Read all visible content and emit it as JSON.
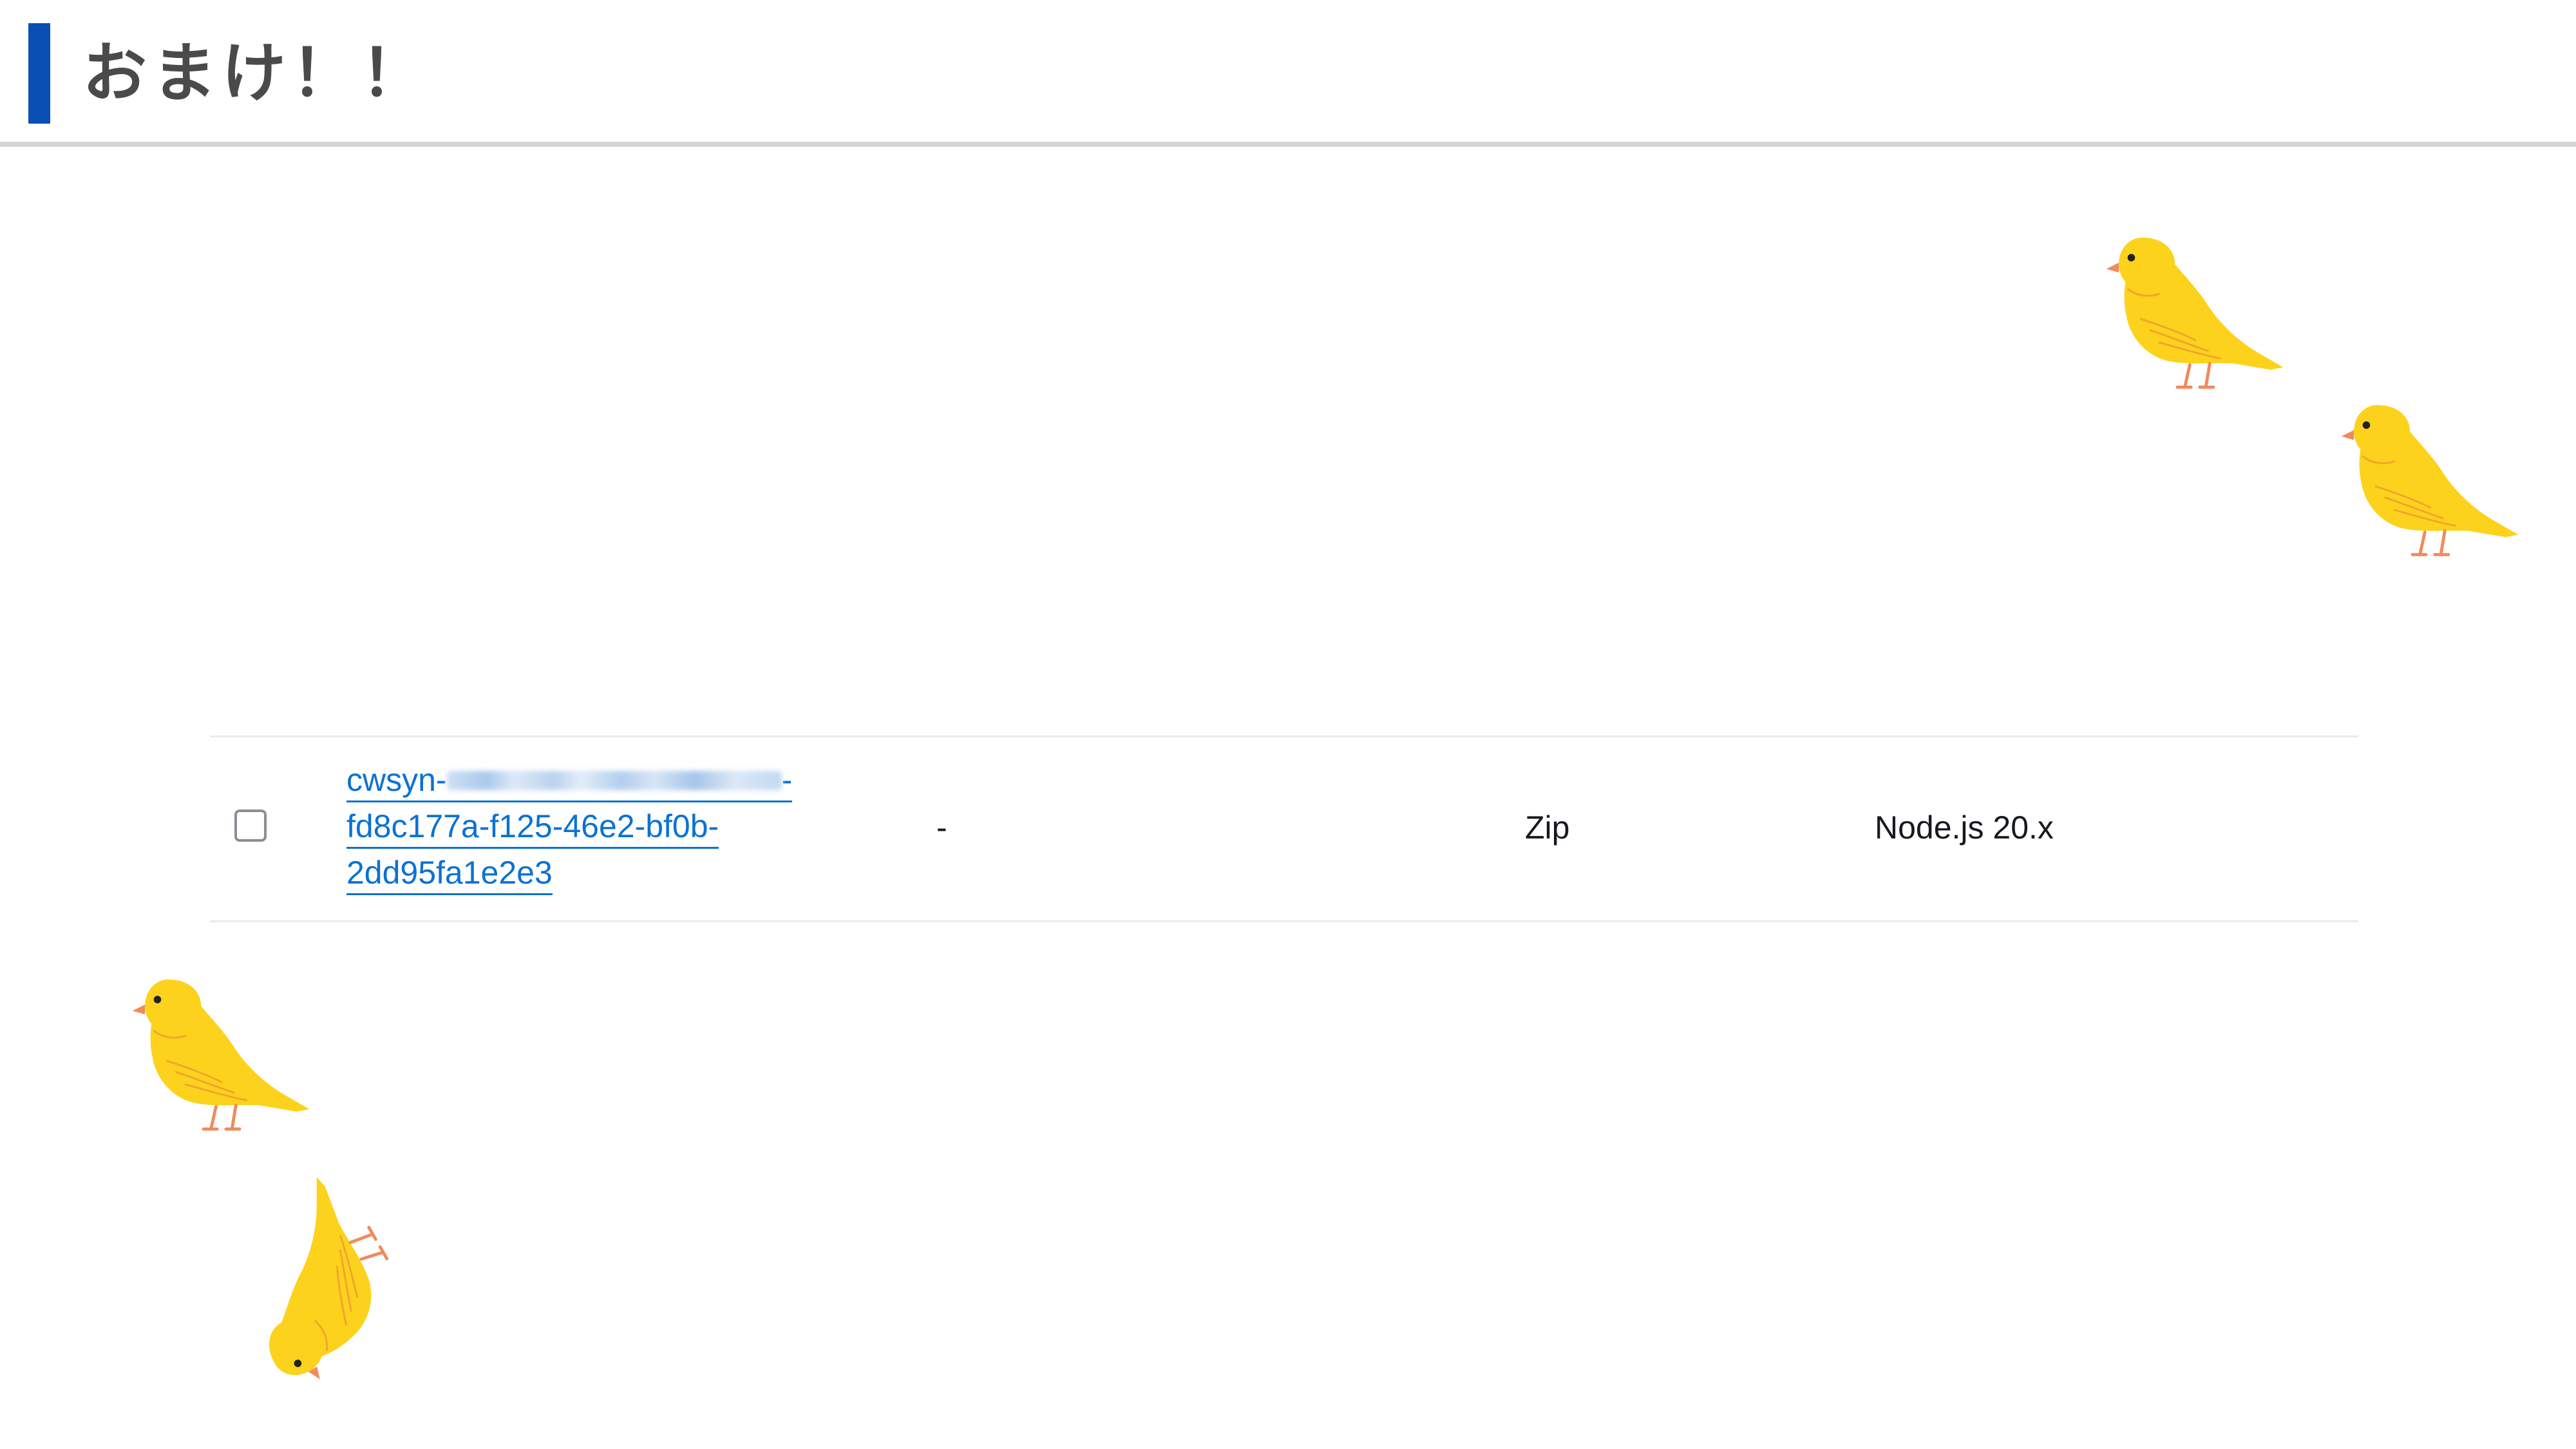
{
  "header": {
    "title": "おまけ！！"
  },
  "function_row": {
    "checkbox_checked": false,
    "name_line1_prefix": "cwsyn-",
    "name_line1_suffix": "-",
    "name_line2": "fd8c177a-f125-46e2-bf0b-",
    "name_line3": "2dd95fa1e2e3",
    "description": "-",
    "package_type": "Zip",
    "runtime": "Node.js 20.x"
  },
  "decorations": {
    "bird_color": "#fcd21c",
    "bird_icon": "canary-bird-icon"
  },
  "colors": {
    "accent": "#0a50b4",
    "link": "#0972d3",
    "title_text": "#4a4a4a",
    "divider": "#d4d4d4"
  }
}
